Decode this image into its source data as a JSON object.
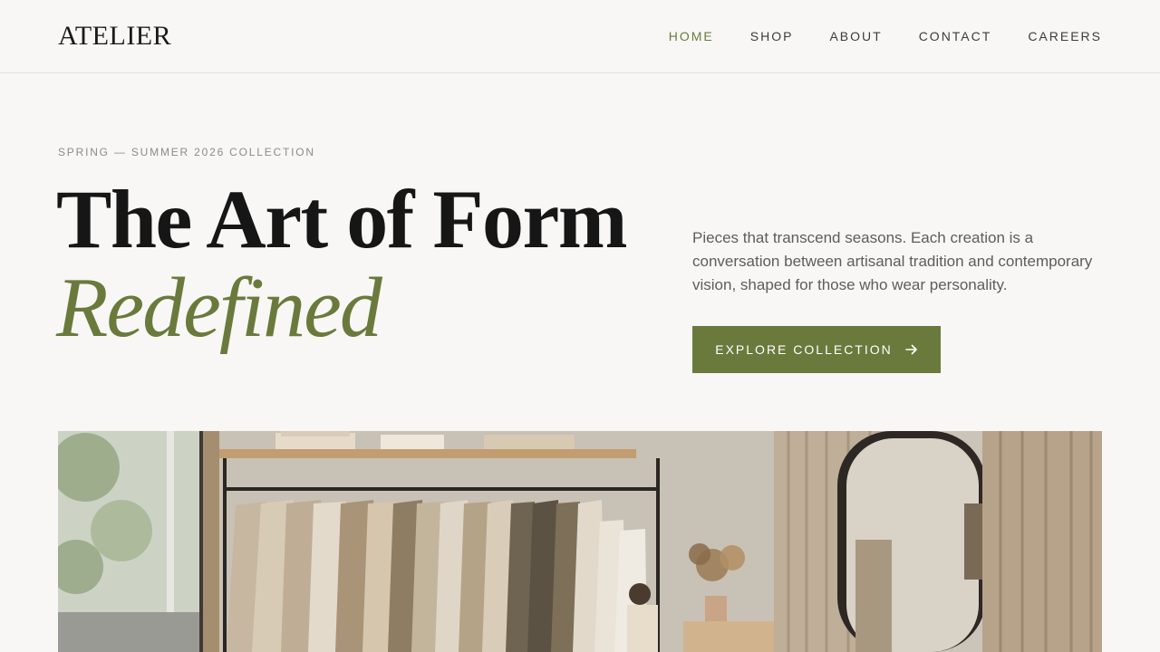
{
  "brand": {
    "logo": "ATELIER"
  },
  "nav": {
    "items": [
      {
        "label": "HOME",
        "active": true
      },
      {
        "label": "SHOP",
        "active": false
      },
      {
        "label": "ABOUT",
        "active": false
      },
      {
        "label": "CONTACT",
        "active": false
      },
      {
        "label": "CAREERS",
        "active": false
      }
    ]
  },
  "hero": {
    "eyebrow": "SPRING — SUMMER 2026 COLLECTION",
    "title_line1": "The Art of Form",
    "title_line2": "Redefined",
    "description": "Pieces that transcend seasons. Each creation is a conversation between artisanal tradition and contemporary vision, shaped for those who wear personality.",
    "cta_label": "EXPLORE COLLECTION",
    "cta_icon": "arrow-right-icon",
    "image_icon": "boutique-interior-photo"
  },
  "colors": {
    "accent": "#6a7a3c",
    "background": "#f8f7f5",
    "text": "#161616",
    "muted": "#8d8b88"
  }
}
